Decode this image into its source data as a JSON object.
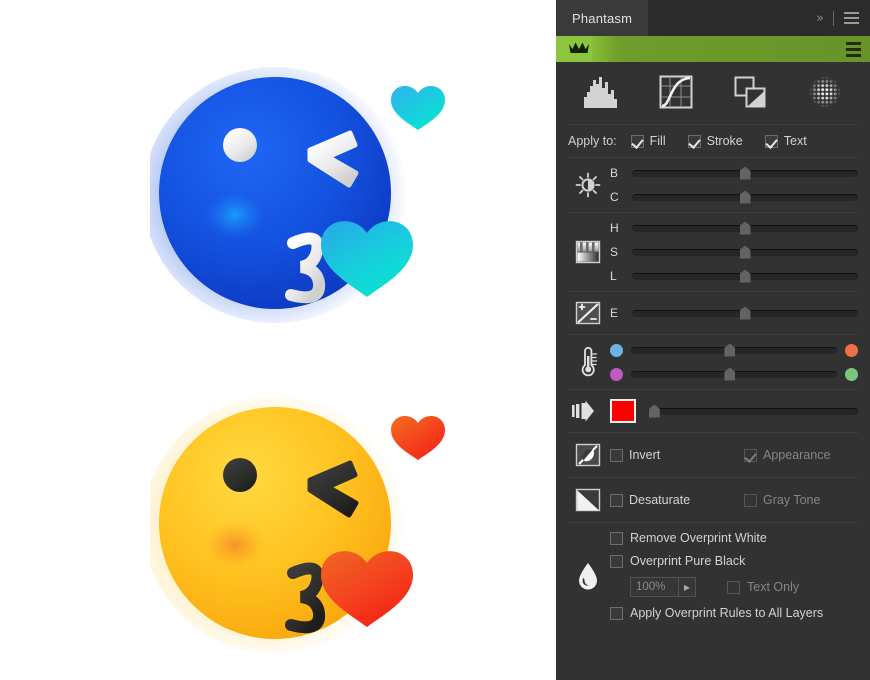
{
  "window": {
    "tab_label": "Phantasm",
    "expand_icon": "chevron-double-right-icon",
    "menu_icon": "hamburger-menu-icon"
  },
  "promo_bar": {
    "crown_icon": "crown-icon",
    "menu_icon": "hamburger-menu-icon",
    "bright_green": "#8cc63e",
    "dark_green": "#68932a"
  },
  "tools": [
    {
      "name": "histogram-tool",
      "icon": "histogram-icon",
      "active": true
    },
    {
      "name": "curves-tool",
      "icon": "curves-icon",
      "active": false
    },
    {
      "name": "duotone-tool",
      "icon": "overlapping-squares-icon",
      "active": false
    },
    {
      "name": "halftone-tool",
      "icon": "halftone-dots-icon",
      "active": false
    }
  ],
  "apply_to": {
    "label": "Apply to:",
    "options": [
      {
        "label": "Fill",
        "checked": true
      },
      {
        "label": "Stroke",
        "checked": true
      },
      {
        "label": "Text",
        "checked": true
      }
    ]
  },
  "brightness_contrast": {
    "icon": "brightness-sun-icon",
    "sliders": [
      {
        "key": "B",
        "name": "brightness-slider",
        "value": 50
      },
      {
        "key": "C",
        "name": "contrast-slider",
        "value": 50
      }
    ]
  },
  "hsl": {
    "icon": "levels-gradient-icon",
    "sliders": [
      {
        "key": "H",
        "name": "hue-slider",
        "value": 50
      },
      {
        "key": "S",
        "name": "saturation-slider",
        "value": 50
      },
      {
        "key": "L",
        "name": "lightness-slider",
        "value": 50
      }
    ]
  },
  "exposure": {
    "icon": "exposure-plus-minus-icon",
    "sliders": [
      {
        "key": "E",
        "name": "exposure-slider",
        "value": 50
      }
    ]
  },
  "temperature": {
    "icon": "thermometer-icon",
    "sliders": [
      {
        "name": "temperature-slider",
        "value": 48,
        "left_dot_color": "#6cb4e8",
        "right_dot_color": "#ef7145"
      },
      {
        "name": "tint-slider",
        "value": 48,
        "left_dot_color": "#c05ac0",
        "right_dot_color": "#79c87c"
      }
    ]
  },
  "colorize": {
    "icon": "blend-arrow-icon",
    "swatch_color": "#ff0000",
    "slider": {
      "name": "colorize-amount-slider",
      "value": 3
    }
  },
  "invert_row": {
    "icon": "invert-circle-icon",
    "options": [
      {
        "label": "Invert",
        "checked": false,
        "enabled": true
      },
      {
        "label": "Appearance",
        "checked": true,
        "enabled": false
      }
    ]
  },
  "desaturate_row": {
    "icon": "desaturate-split-icon",
    "options": [
      {
        "label": "Desaturate",
        "checked": false,
        "enabled": true
      },
      {
        "label": "Gray Tone",
        "checked": false,
        "enabled": false
      }
    ]
  },
  "overprint": {
    "icon": "ink-droplet-icon",
    "options": [
      {
        "label": "Remove Overprint White",
        "checked": false
      },
      {
        "label": "Overprint Pure Black",
        "checked": false
      },
      {
        "label": "Apply Overprint Rules to All Layers",
        "checked": false
      }
    ],
    "percent_value": "100%",
    "percent_stepper_icon": "chevron-right-icon",
    "text_only": {
      "label": "Text Only",
      "checked": false,
      "enabled": false
    }
  },
  "canvas": {
    "artwork_top": {
      "name": "face-blowing-kiss-emoji-recolored",
      "face_color": "#1452e0",
      "heart_color": "#17d0e0",
      "eye_color": "#ececec",
      "mouth_color": "#f0f0f0"
    },
    "artwork_bottom": {
      "name": "face-blowing-kiss-emoji-original",
      "face_color": "#ffc422",
      "heart_color": "#f5402a",
      "eye_color": "#2a2a2a",
      "mouth_color": "#2a2a2a"
    }
  }
}
